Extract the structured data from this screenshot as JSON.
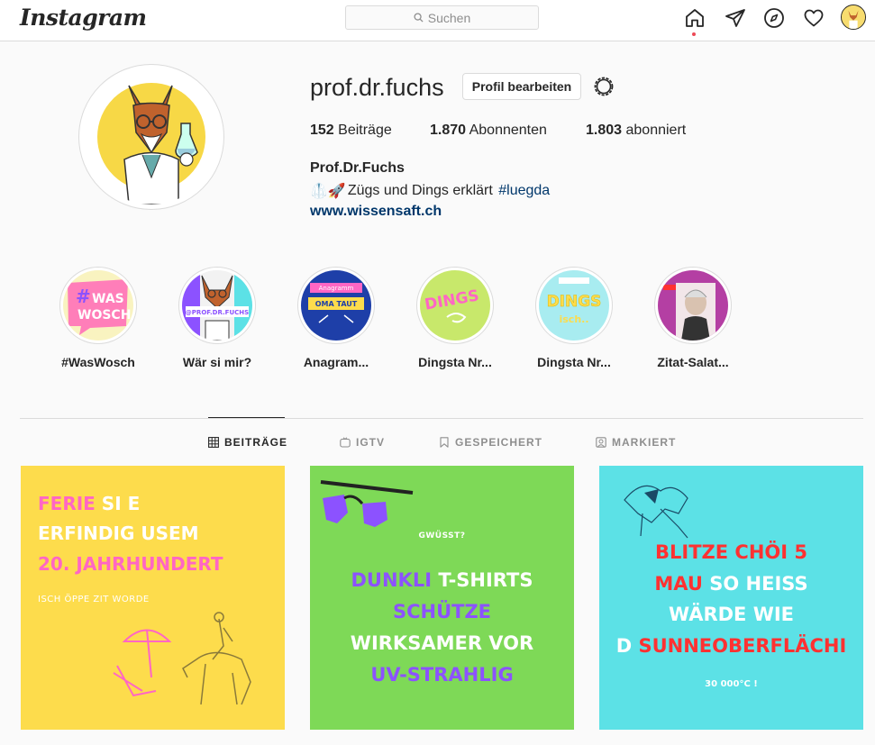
{
  "nav": {
    "logo": "Instagram",
    "search_placeholder": "Suchen"
  },
  "profile": {
    "username": "prof.dr.fuchs",
    "edit_button": "Profil bearbeiten",
    "stats": {
      "posts_count": "152",
      "posts_label": "Beiträge",
      "followers_count": "1.870",
      "followers_label": "Abonnenten",
      "following_count": "1.803",
      "following_label": "abonniert"
    },
    "full_name": "Prof.Dr.Fuchs",
    "bio_emoji": "🥼🚀",
    "bio_text": "Zügs und Dings erklärt ",
    "bio_hashtag": "#luegda",
    "website": "www.wissensaft.ch"
  },
  "highlights": [
    {
      "label": "#WasWosch",
      "art_text_1": "#",
      "art_text_2": "WAS",
      "art_text_3": "WOSCH"
    },
    {
      "label": "Wär si mir?",
      "art_text_1": "@PROF.DR.FUCHS"
    },
    {
      "label": "Anagram...",
      "art_text_1": "Anagramm",
      "art_text_2": "OMA TAUT"
    },
    {
      "label": "Dingsta Nr...",
      "art_text_1": "DINGS"
    },
    {
      "label": "Dingsta Nr...",
      "art_text_1": "DINGS",
      "art_text_2": "isch.."
    },
    {
      "label": "Zitat-Salat..."
    }
  ],
  "tabs": [
    {
      "label": "BEITRÄGE",
      "icon": "grid-icon",
      "active": true
    },
    {
      "label": "IGTV",
      "icon": "tv-icon",
      "active": false
    },
    {
      "label": "GESPEICHERT",
      "icon": "bookmark-icon",
      "active": false
    },
    {
      "label": "MARKIERT",
      "icon": "tagged-icon",
      "active": false
    }
  ],
  "posts": [
    {
      "bg": "#fddc4c",
      "line1_a": "FERIE",
      "line1_b": " SI E",
      "line2": "ERFINDIG USEM",
      "line3": "20. JAHRHUNDERT",
      "sub": "ISCH ÖPPE ZIT WORDE"
    },
    {
      "bg": "#7ed957",
      "kicker": "GWÜSST?",
      "line1_a": "DUNKLI",
      "line1_b": " T-SHIRTS",
      "line2": "SCHÜTZE",
      "line3": "WIRKSAMER VOR",
      "line4": "UV-STRAHLIG"
    },
    {
      "bg": "#5ce1e6",
      "line1": "BLITZE CHÖI 5",
      "line2_a": "MAU",
      "line2_b": " SO HEISS",
      "line3": "WÄRDE WIE",
      "line4_a": "D ",
      "line4_b": "SUNNEOBERFLÄCHI",
      "sub": "30 000°C !"
    }
  ],
  "colors": {
    "pink": "#ff66c4",
    "purple": "#8c52ff",
    "red": "#ff3131",
    "link": "#00376b"
  }
}
